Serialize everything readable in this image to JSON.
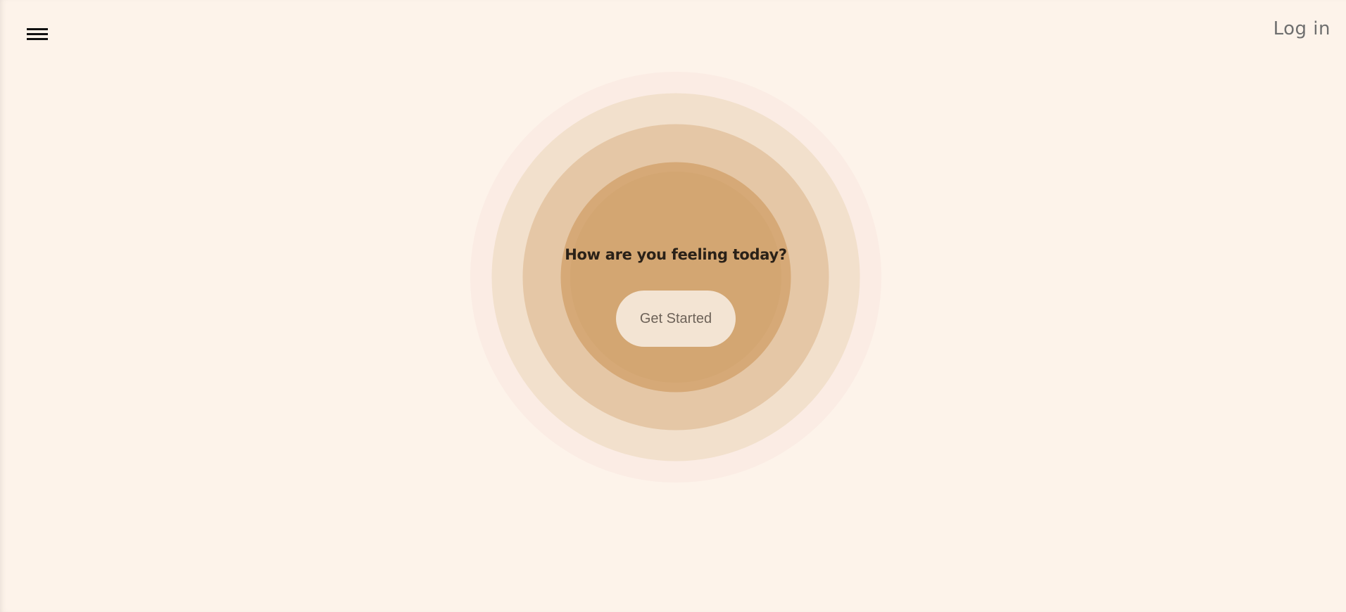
{
  "header": {
    "menu_icon": "hamburger-menu-icon",
    "login_label": "Log in"
  },
  "hero": {
    "prompt": "How are you feeling today?",
    "cta_label": "Get Started"
  },
  "colors": {
    "background": "#fdf3ea",
    "ring_outer": "#fbece4",
    "ring_2": "#f2e0cc",
    "ring_3": "#e5c7a6",
    "ring_inner": "#d3a672",
    "button_bg": "#f3e4d3"
  }
}
